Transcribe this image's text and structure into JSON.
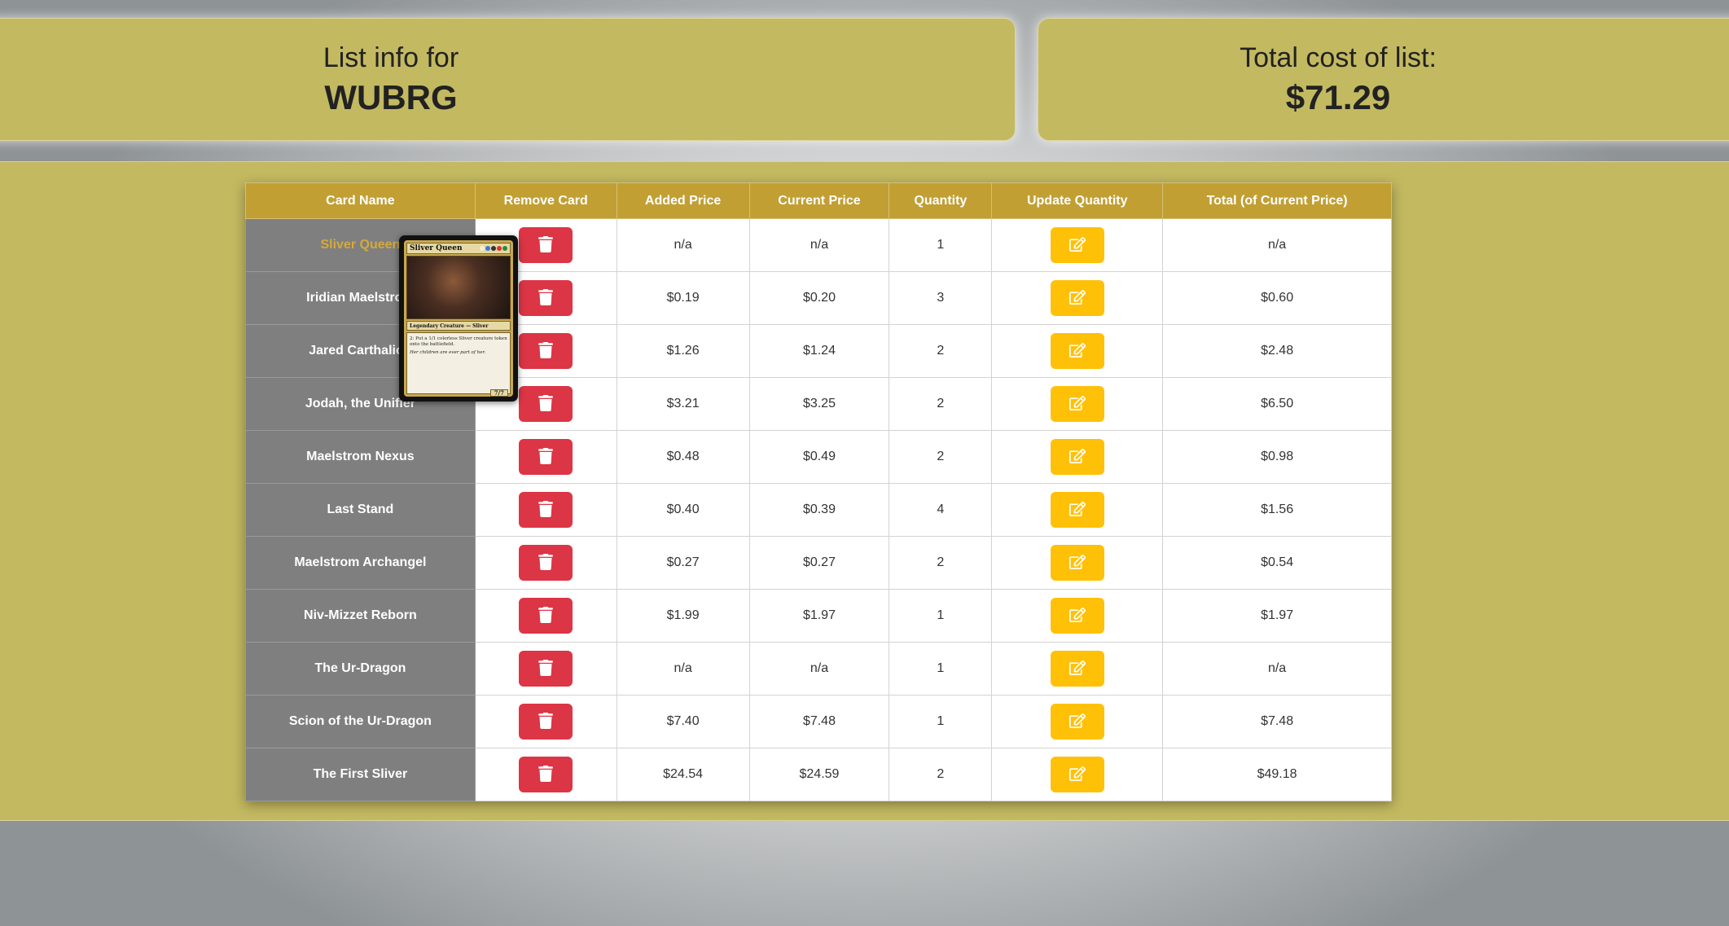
{
  "list_info": {
    "label": "List info for",
    "list_name": "WUBRG"
  },
  "total_cost": {
    "label": "Total cost of list:",
    "value": "$71.29"
  },
  "table": {
    "headers": [
      "Card Name",
      "Remove Card",
      "Added Price",
      "Current Price",
      "Quantity",
      "Update Quantity",
      "Total (of Current Price)"
    ],
    "rows": [
      {
        "name": "Sliver Queen",
        "added": "n/a",
        "current": "n/a",
        "qty": "1",
        "total": "n/a"
      },
      {
        "name": "Iridian Maelstrom",
        "added": "$0.19",
        "current": "$0.20",
        "qty": "3",
        "total": "$0.60"
      },
      {
        "name": "Jared Carthalion",
        "added": "$1.26",
        "current": "$1.24",
        "qty": "2",
        "total": "$2.48"
      },
      {
        "name": "Jodah, the Unifier",
        "added": "$3.21",
        "current": "$3.25",
        "qty": "2",
        "total": "$6.50"
      },
      {
        "name": "Maelstrom Nexus",
        "added": "$0.48",
        "current": "$0.49",
        "qty": "2",
        "total": "$0.98"
      },
      {
        "name": "Last Stand",
        "added": "$0.40",
        "current": "$0.39",
        "qty": "4",
        "total": "$1.56"
      },
      {
        "name": "Maelstrom Archangel",
        "added": "$0.27",
        "current": "$0.27",
        "qty": "2",
        "total": "$0.54"
      },
      {
        "name": "Niv-Mizzet Reborn",
        "added": "$1.99",
        "current": "$1.97",
        "qty": "1",
        "total": "$1.97"
      },
      {
        "name": "The Ur-Dragon",
        "added": "n/a",
        "current": "n/a",
        "qty": "1",
        "total": "n/a"
      },
      {
        "name": "Scion of the Ur-Dragon",
        "added": "$7.40",
        "current": "$7.48",
        "qty": "1",
        "total": "$7.48"
      },
      {
        "name": "The First Sliver",
        "added": "$24.54",
        "current": "$24.59",
        "qty": "2",
        "total": "$49.18"
      }
    ],
    "remove_icon": "trash-icon",
    "update_icon": "edit-icon"
  },
  "card_preview": {
    "title": "Sliver Queen",
    "type_line": "Legendary Creature — Sliver",
    "rules_text": "2: Put a 1/1 colorless Sliver creature token onto the battlefield.",
    "flavor_text": "Her children are ever part of her.",
    "power_toughness": "7/7"
  },
  "colors": {
    "panel": "#c3b961",
    "header": "#c29f33",
    "name_cell": "#7f7f7f",
    "hover_name": "#d6a93a",
    "delete_button": "#dc3545",
    "edit_button": "#ffc107"
  }
}
